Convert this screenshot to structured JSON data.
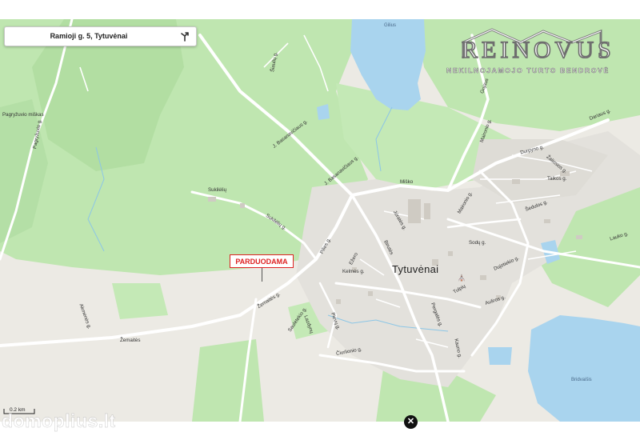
{
  "search": {
    "address": "Ramioji g. 5, Tytuvėnai",
    "icon": "directions-icon"
  },
  "logo": {
    "name": "REINOVUS",
    "tagline": "NEKILNOJAMOJO TURTO BENDROVĖ"
  },
  "marker": {
    "label": "PARDUODAMA",
    "color": "#dd2222"
  },
  "town": "Tytuvėnai",
  "places": {
    "forest": "Pagryžuvio miškas",
    "lake_north": "Gilius",
    "lake_south": "Bridvaišis"
  },
  "streets": {
    "basanaviciaus": "J. Basanavičiaus g.",
    "misko": "Miško",
    "sukilelių": "Sukilėlių",
    "sukileliu_road": "Sukilėlių g.",
    "zemaites": "Žemaitės g.",
    "zemaites_w": "Žemaitės",
    "akmenes": "Akmenės g.",
    "kelmes": "Kelmės g.",
    "maironio": "Maironio g.",
    "durpyno": "Durpyno g.",
    "dariaus": "Dariaus g.",
    "taikos": "Taikos g.",
    "sodu": "Sodų g.",
    "laukos": "Lauko g.",
    "ciurlionio": "Čiurlionio g.",
    "pergales": "Pergalės g.",
    "pievu": "Pievų g.",
    "sedulos": "Šedulos g.",
    "dujotiekio": "Dujotiekio g.",
    "sauletekio": "Saulėtekio g.",
    "ezero": "Ežero",
    "pilies": "Pilies g.",
    "birutes": "Birutės",
    "jurates": "Jūratės g.",
    "lazdynu": "Lazdynų",
    "pagryzuvio": "Pagryžuvio g.",
    "siauliu": "Šiaulių g.",
    "kauno": "Kauno g.",
    "aurosos": "Aušros g.",
    "tulpiu": "Tulpių",
    "zaliojo": "Žaliosios g.",
    "gojaus": "Gojaus"
  },
  "scale": "0.2 km",
  "watermark": "domoplius.lt",
  "close": "✕",
  "colors": {
    "forest": "#bfe6b0",
    "field": "#eceae4",
    "water": "#a9d4ee",
    "urban": "#e3e1dc",
    "road": "#ffffff"
  }
}
